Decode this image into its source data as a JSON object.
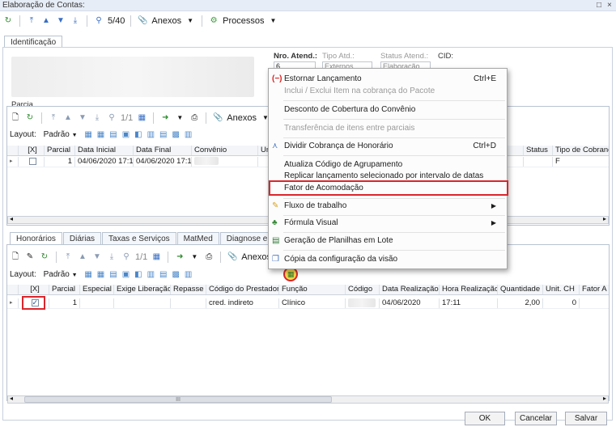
{
  "window": {
    "title": "Elaboração de Contas:",
    "controls": [
      "□",
      "×"
    ]
  },
  "top_toolbar": {
    "record_counter": "5/40",
    "anexos": "Anexos",
    "processos": "Processos"
  },
  "tabs_top": [
    "Identificação"
  ],
  "atend": {
    "nro_label": "Nro. Atend.:",
    "nro_value": "6",
    "tipo_label": "Tipo Atd.:",
    "tipo_value": "Externos",
    "status_label": "Status Atend.:",
    "status_value": "Elaboração",
    "cid_label": "CID:"
  },
  "parcial_section": {
    "title": "Parcia",
    "toolbar": {
      "counter": "1/1",
      "anexos": "Anexos"
    },
    "layout_label": "Layout:",
    "layout_value": "Padrão",
    "columns": [
      "[X]",
      "Parcial",
      "Data Inicial",
      "Data Final",
      "Convênio",
      "Un",
      "Status",
      "Tipo de Cobrança"
    ],
    "row": {
      "parcial": "1",
      "data_inicial": "04/06/2020 17:11",
      "data_final": "04/06/2020 17:11",
      "tipo_cobranca": "F"
    }
  },
  "tabs_bottom": [
    "Honorários",
    "Diárias",
    "Taxas e Serviços",
    "MatMed",
    "Diagnose e Ter"
  ],
  "honorarios": {
    "toolbar": {
      "counter": "1/1",
      "anexos": "Anexos"
    },
    "layout_label": "Layout:",
    "layout_value": "Padrão",
    "columns": [
      "[X]",
      "Parcial",
      "Especial",
      "Exige Liberação",
      "Repasse",
      "Código do Prestador",
      "Função",
      "Código",
      "Data Realização",
      "Hora Realização",
      "Quantidade",
      "Unit. CH",
      "Fator A"
    ],
    "row": {
      "parcial": "1",
      "prestador": "cred. indireto",
      "funcao": "Clínico",
      "data": "04/06/2020",
      "hora": "17:11",
      "quantidade": "2,00",
      "unit_ch": "0"
    },
    "scroll_glyph": "III"
  },
  "context_menu": {
    "items": [
      {
        "label": "Estornar Lançamento",
        "shortcut": "Ctrl+E",
        "icon": "minus-icon"
      },
      {
        "label": "Inclui / Exclui Item na cobrança do Pacote",
        "disabled": true
      },
      {
        "label": "Desconto de Cobertura do Convênio"
      },
      {
        "label": "Transferência de itens entre parciais",
        "disabled": true
      },
      {
        "label": "Dividir Cobrança de Honorário",
        "shortcut": "Ctrl+D",
        "icon": "split-icon"
      },
      {
        "label": "Atualiza Código de Agrupamento"
      },
      {
        "label": "Replicar lançamento selecionado por intervalo de datas"
      },
      {
        "label": "Fator de Acomodação"
      },
      {
        "label": "Fluxo de trabalho",
        "submenu": true,
        "icon": "workflow-icon"
      },
      {
        "label": "Fórmula Visual",
        "submenu": true,
        "icon": "formula-icon"
      },
      {
        "label": "Geração de Planilhas em Lote",
        "icon": "spreadsheet-icon"
      },
      {
        "label": "Cópia da configuração da visão",
        "icon": "copy-icon"
      }
    ]
  },
  "footer": {
    "ok": "OK",
    "cancelar": "Cancelar",
    "salvar": "Salvar"
  },
  "colors": {
    "highlight_red": "#d9262c",
    "title_bg": "#e7edf6"
  }
}
